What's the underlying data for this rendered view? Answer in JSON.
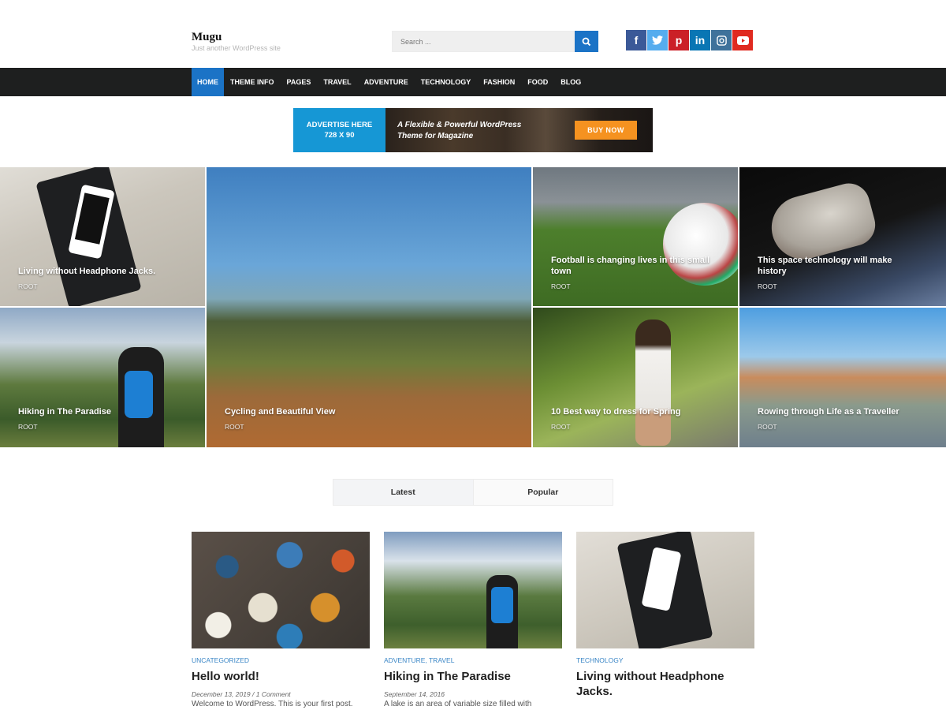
{
  "site": {
    "title": "Mugu",
    "tagline": "Just another WordPress site"
  },
  "search": {
    "placeholder": "Search ...",
    "button_icon": "search-icon"
  },
  "social": [
    {
      "name": "facebook",
      "icon": "facebook-icon",
      "glyph": "f",
      "color": "#3b5998"
    },
    {
      "name": "twitter",
      "icon": "twitter-icon",
      "glyph": "t",
      "color": "#55acee"
    },
    {
      "name": "pinterest",
      "icon": "pinterest-icon",
      "glyph": "p",
      "color": "#cb2027"
    },
    {
      "name": "linkedin",
      "icon": "linkedin-icon",
      "glyph": "in",
      "color": "#0976b4"
    },
    {
      "name": "instagram",
      "icon": "instagram-icon",
      "glyph": "◎",
      "color": "#3f729b"
    },
    {
      "name": "youtube",
      "icon": "youtube-icon",
      "glyph": "▶",
      "color": "#e02a20"
    }
  ],
  "nav": {
    "items": [
      "HOME",
      "THEME INFO",
      "PAGES",
      "TRAVEL",
      "ADVENTURE",
      "TECHNOLOGY",
      "FASHION",
      "FOOD",
      "BLOG"
    ],
    "active": "HOME",
    "active_color": "#1b73c6"
  },
  "ad": {
    "left_line1": "ADVERTISE HERE",
    "left_line2": "728 X 90",
    "tagline_line1": "A Flexible & Powerful WordPress",
    "tagline_line2": "Theme for Magazine",
    "button": "BUY NOW"
  },
  "featured": [
    {
      "title": "Living without Headphone Jacks.",
      "category": "ROOT"
    },
    {
      "title": "Hiking in The Paradise",
      "category": "ROOT"
    },
    {
      "title": "Cycling and Beautiful View",
      "category": "ROOT"
    },
    {
      "title": "Football is changing lives in this small town",
      "category": "ROOT"
    },
    {
      "title": "This space technology will make history",
      "category": "ROOT"
    },
    {
      "title": "10 Best way to dress for Spring",
      "category": "ROOT"
    },
    {
      "title": "Rowing through Life as a Traveller",
      "category": "ROOT"
    }
  ],
  "tabs": {
    "latest": "Latest",
    "popular": "Popular"
  },
  "posts": [
    {
      "category": "UNCATEGORIZED",
      "title": "Hello world!",
      "meta": "December 13, 2019 /  1 Comment",
      "excerpt": "Welcome to WordPress. This is your first post."
    },
    {
      "category": "ADVENTURE, TRAVEL",
      "title": "Hiking in The Paradise",
      "meta": "September 14, 2016",
      "excerpt": "A lake is an area of variable size filled with"
    },
    {
      "category": "TECHNOLOGY",
      "title": "Living without Headphone Jacks.",
      "meta": "",
      "excerpt": ""
    }
  ]
}
